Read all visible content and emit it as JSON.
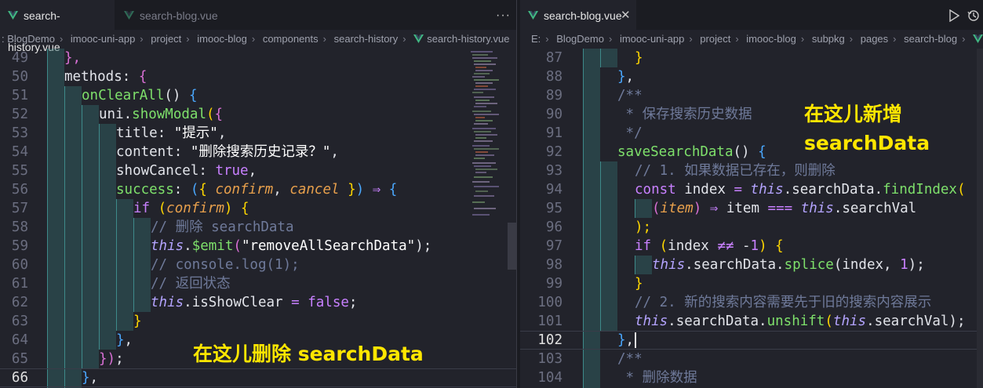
{
  "colors": {
    "accent_vue": "#41b883",
    "annotation": "#ffe600",
    "keyword": "#c880ff",
    "function": "#7ee06b",
    "comment": "#6f7a9a"
  },
  "left": {
    "tabs": [
      {
        "label": "search-history.vue",
        "active": true,
        "icon": "vue-icon"
      },
      {
        "label": "search-blog.vue",
        "active": false,
        "icon": "vue-icon"
      }
    ],
    "more_label": "···",
    "breadcrumb": [
      "BlogDemo",
      "imooc-uni-app",
      "project",
      "imooc-blog",
      "components",
      "search-history",
      "search-history.vue"
    ],
    "breadcrumb_prefix": ":",
    "current_line": "66",
    "lines": [
      {
        "n": "49"
      },
      {
        "n": "50"
      },
      {
        "n": "51"
      },
      {
        "n": "52"
      },
      {
        "n": "53"
      },
      {
        "n": "54"
      },
      {
        "n": "55"
      },
      {
        "n": "56"
      },
      {
        "n": "57"
      },
      {
        "n": "58"
      },
      {
        "n": "59"
      },
      {
        "n": "60"
      },
      {
        "n": "61"
      },
      {
        "n": "62"
      },
      {
        "n": "63"
      },
      {
        "n": "64"
      },
      {
        "n": "65"
      },
      {
        "n": "66"
      }
    ],
    "annotation": "在这儿删除 searchData"
  },
  "right": {
    "tabs": [
      {
        "label": "search-blog.vue",
        "active": true,
        "icon": "vue-icon"
      }
    ],
    "breadcrumb": [
      "E:",
      "BlogDemo",
      "imooc-uni-app",
      "project",
      "imooc-blog",
      "subpkg",
      "pages",
      "search-blog",
      "sea"
    ],
    "current_line": "102",
    "lines": [
      {
        "n": "87"
      },
      {
        "n": "88"
      },
      {
        "n": "89"
      },
      {
        "n": "90"
      },
      {
        "n": "91"
      },
      {
        "n": "92"
      },
      {
        "n": "93"
      },
      {
        "n": "94"
      },
      {
        "n": "95"
      },
      {
        "n": "96"
      },
      {
        "n": "97"
      },
      {
        "n": "98"
      },
      {
        "n": "99"
      },
      {
        "n": "100"
      },
      {
        "n": "101"
      },
      {
        "n": "102"
      },
      {
        "n": "103"
      },
      {
        "n": "104"
      }
    ],
    "annotation_line1": "在这儿新增",
    "annotation_line2": "searchData"
  },
  "code_left": {
    "l49": "},",
    "l50_a": "methods",
    "l50_b": ": ",
    "l50_c": "{",
    "l51_a": "onClearAll",
    "l51_b": "() ",
    "l51_c": "{",
    "l52_a": "uni",
    "l52_b": ".",
    "l52_c": "showModal",
    "l52_d": "(",
    "l52_e": "{",
    "l53_a": "title",
    "l53_b": ": ",
    "l53_c": "\"提示\"",
    "l53_d": ",",
    "l54_a": "content",
    "l54_b": ": ",
    "l54_c": "\"删除搜索历史记录？\"",
    "l54_d": ",",
    "l55_a": "showCancel",
    "l55_b": ": ",
    "l55_c": "true",
    "l55_d": ",",
    "l56_a": "success",
    "l56_b": ": ",
    "l56_c": "(",
    "l56_d": "{ ",
    "l56_e": "confirm",
    "l56_f": ", ",
    "l56_g": "cancel",
    "l56_h": " }",
    "l56_i": ") ",
    "l56_j": "⇒",
    "l56_k": " {",
    "l57_a": "if",
    "l57_b": " (",
    "l57_c": "confirm",
    "l57_d": ") ",
    "l57_e": "{",
    "l58": "// 删除 searchData",
    "l59_a": "this",
    "l59_b": ".",
    "l59_c": "$emit",
    "l59_d": "(",
    "l59_e": "\"removeAllSearchData\"",
    "l59_f": ");",
    "l60": "// console.log(1);",
    "l61": "// 返回状态",
    "l62_a": "this",
    "l62_b": ".isShowClear ",
    "l62_c": "=",
    "l62_d": " ",
    "l62_e": "false",
    "l62_f": ";",
    "l63": "}",
    "l64_a": "}",
    "l64_b": ",",
    "l65_a": "})",
    "l65_b": ";",
    "l66_a": "}",
    "l66_b": ","
  },
  "code_right": {
    "l87": "}",
    "l88_a": "}",
    "l88_b": ",",
    "l89": "/**",
    "l90": " * 保存搜索历史数据",
    "l91": " */",
    "l92_a": "saveSearchData",
    "l92_b": "() ",
    "l92_c": "{",
    "l93": "// 1. 如果数据已存在，则删除",
    "l94_a": "const",
    "l94_b": " index ",
    "l94_c": "=",
    "l94_d": " ",
    "l94_e": "this",
    "l94_f": ".searchData.",
    "l94_g": "findIndex",
    "l94_h": "(",
    "l95_a": "(",
    "l95_b": "item",
    "l95_c": ") ",
    "l95_d": "⇒",
    "l95_e": " item ",
    "l95_f": "===",
    "l95_g": " ",
    "l95_h": "this",
    "l95_i": ".searchVal",
    "l96": ");",
    "l97_a": "if",
    "l97_b": " (",
    "l97_c": "index ",
    "l97_d": "≠≠",
    "l97_e": " -",
    "l97_f": "1",
    "l97_g": ") ",
    "l97_h": "{",
    "l98_a": "this",
    "l98_b": ".searchData.",
    "l98_c": "splice",
    "l98_d": "(index, ",
    "l98_e": "1",
    "l98_f": ");",
    "l99": "}",
    "l100": "// 2. 新的搜索内容需要先于旧的搜索内容展示",
    "l101_a": "this",
    "l101_b": ".searchData.",
    "l101_c": "unshift",
    "l101_d": "(",
    "l101_e": "this",
    "l101_f": ".searchVal",
    "l101_g": ");",
    "l102_a": "}",
    "l102_b": ",",
    "l103": "/**",
    "l104": " * 删除数据"
  }
}
